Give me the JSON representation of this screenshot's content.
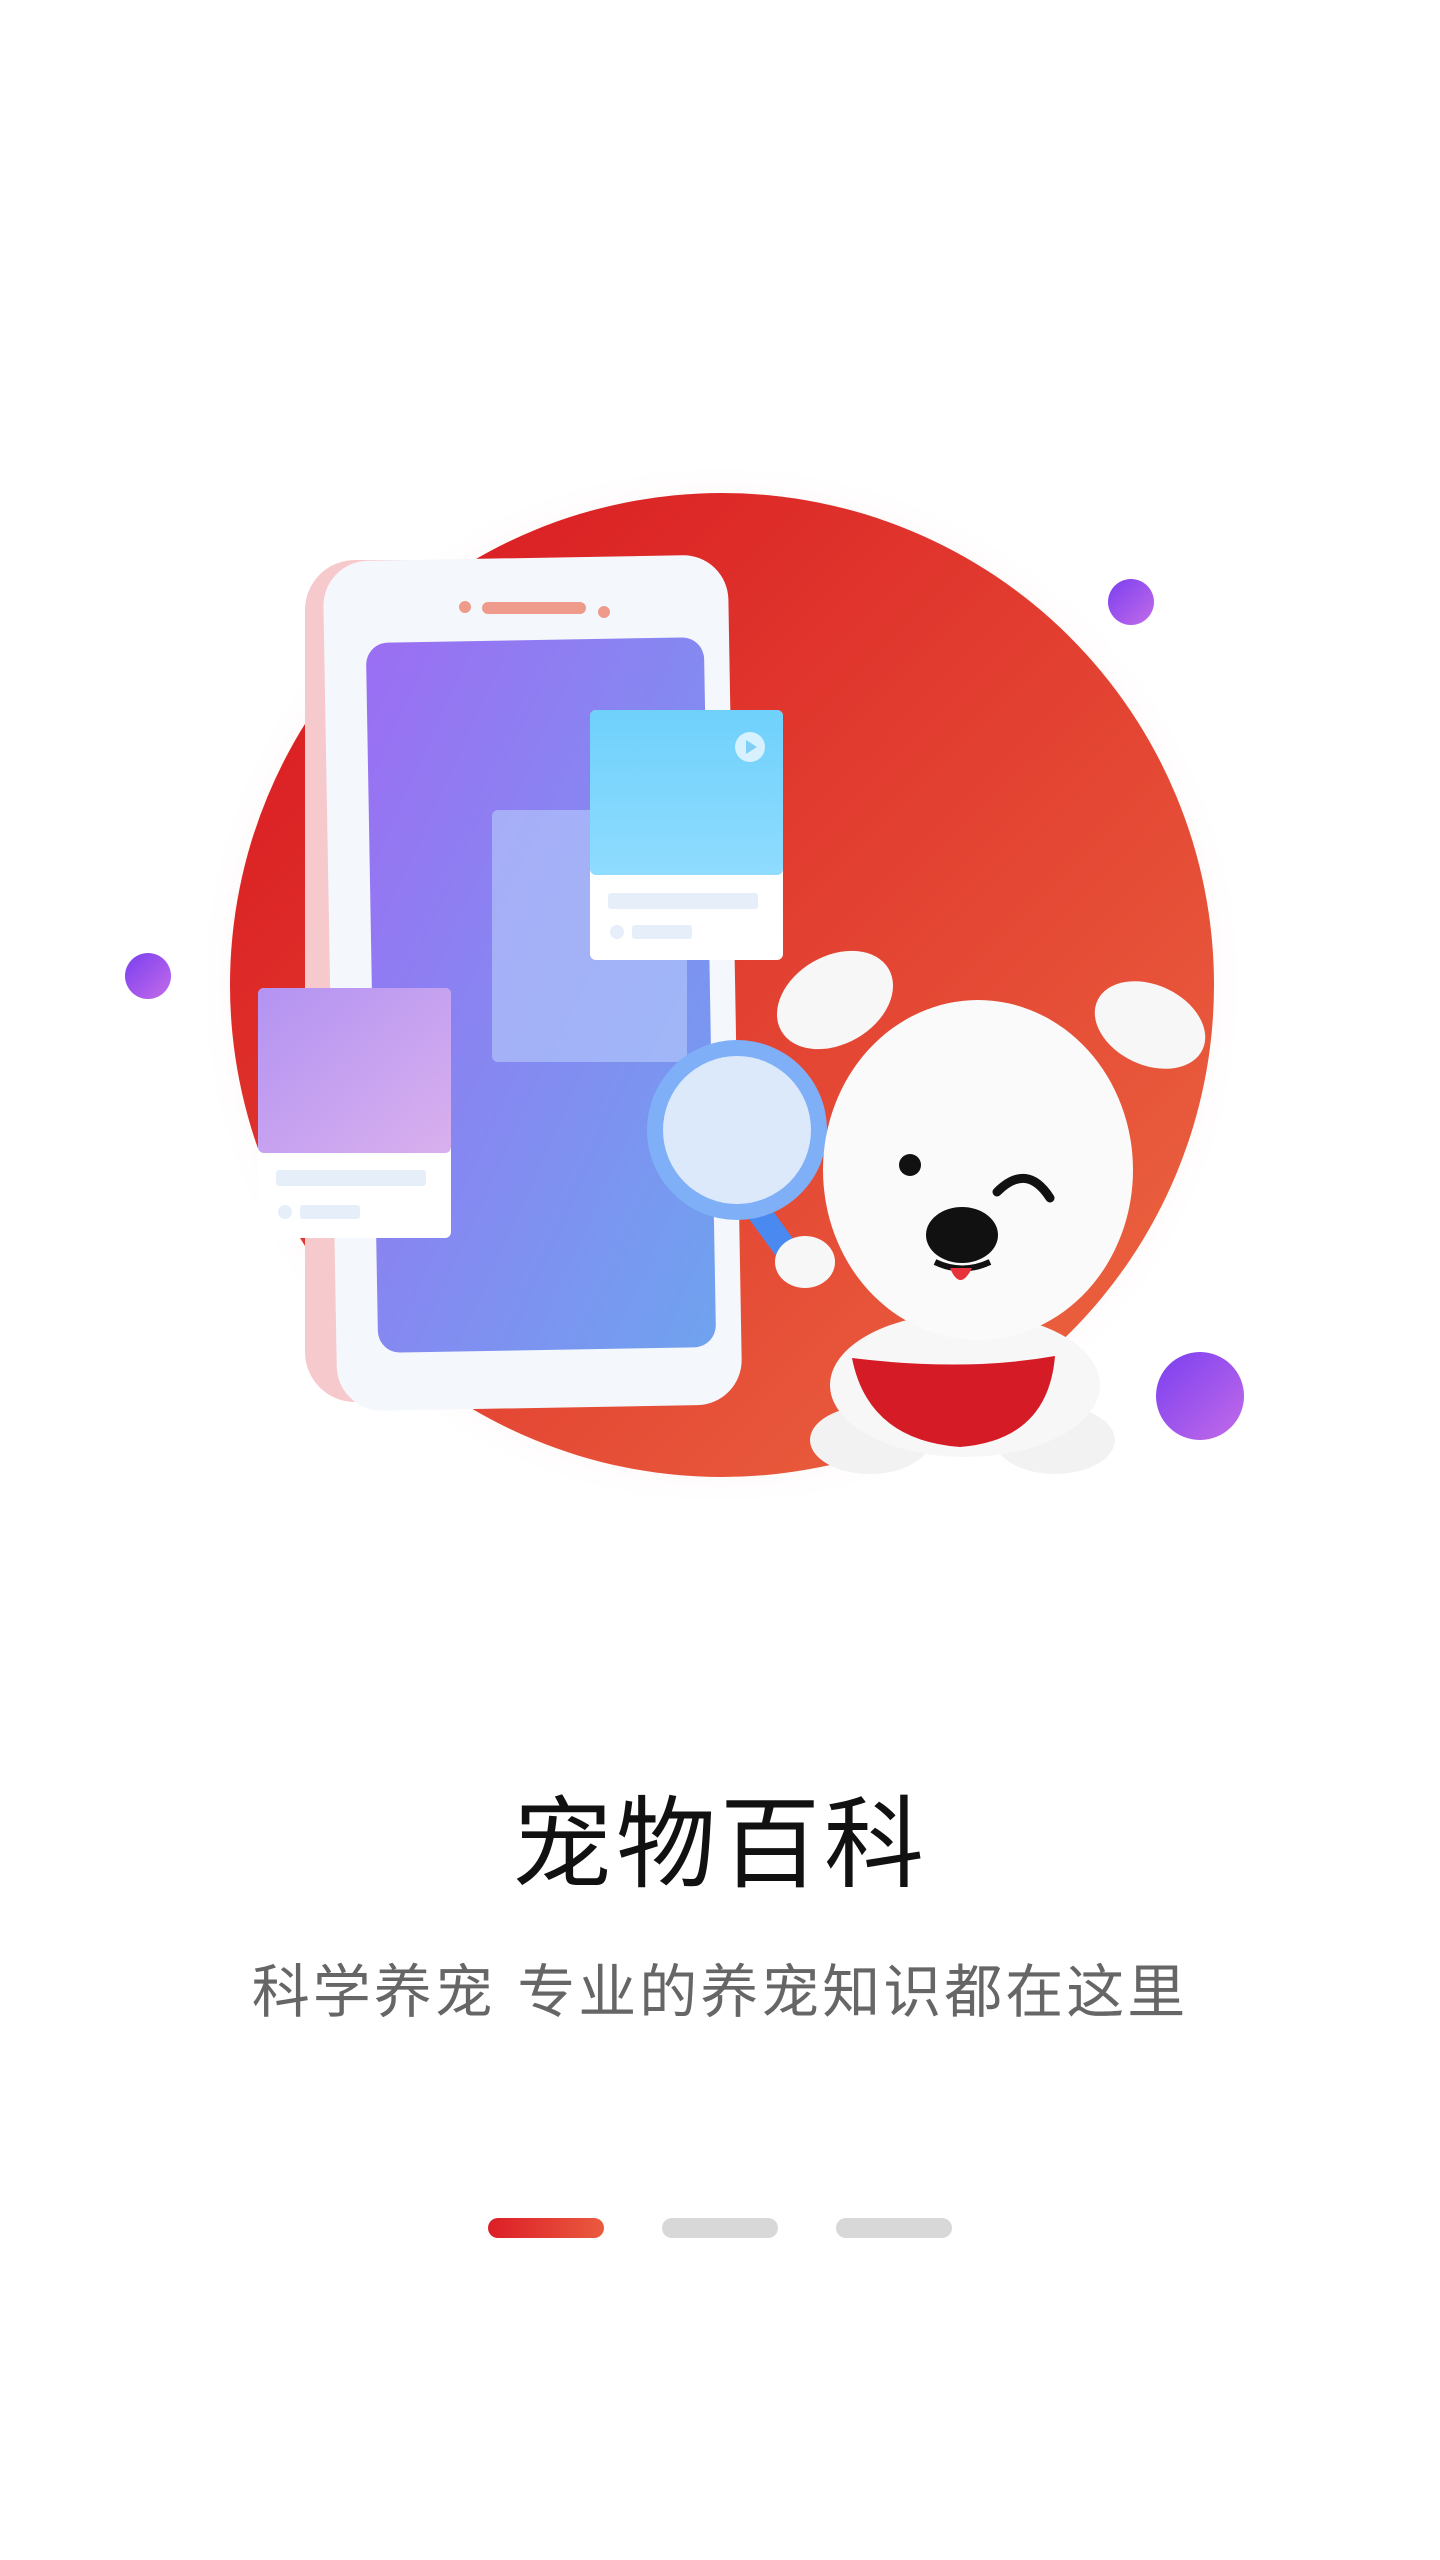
{
  "onboarding": {
    "title": "宠物百科",
    "subtitle": "科学养宠 专业的养宠知识都在这里",
    "page_indicator": {
      "total": 3,
      "active_index": 0
    }
  },
  "colors": {
    "accent": "#dc1e26",
    "accent_end": "#ea5a3f",
    "indicator_inactive": "#d8d8d8",
    "purple": "#8a4cf0"
  },
  "illustration": {
    "icons": [
      "phone-icon",
      "magnifier-icon",
      "dog-mascot"
    ]
  }
}
